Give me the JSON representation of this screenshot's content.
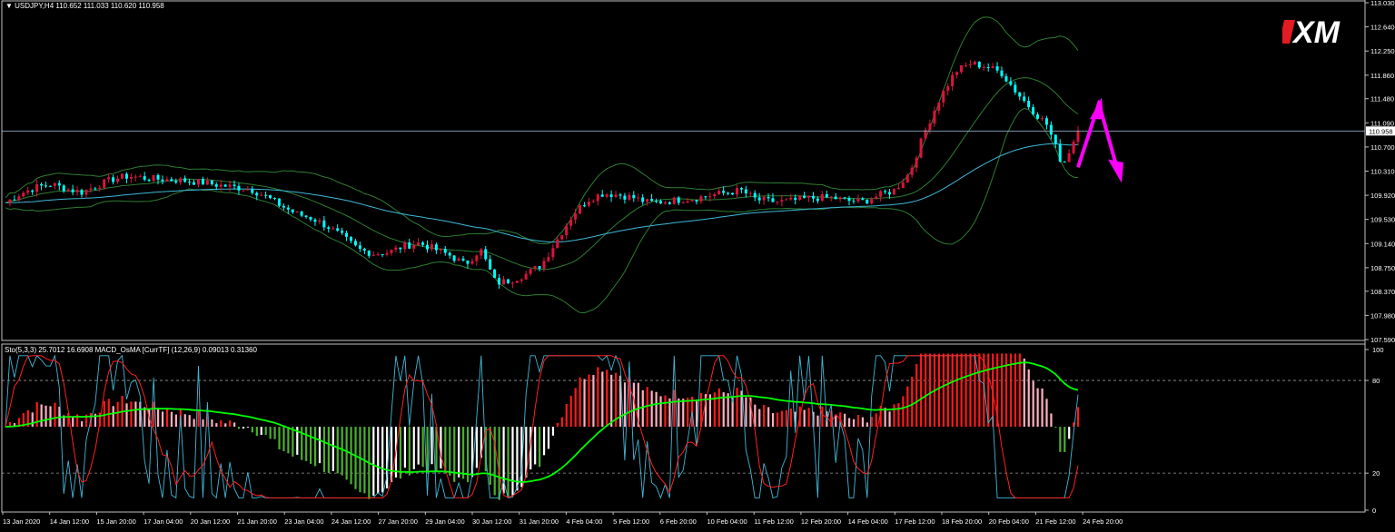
{
  "header": {
    "main": "USDJPY,H4  110.652 111.033 110.620 110.958",
    "sub": "Sto(5,3,3) 25.7012 16.6908  MACD_OsMA [CurrTF] (12,26,9) 0.09013 0.31360"
  },
  "brand": {
    "logo_text": "XM"
  },
  "colors": {
    "background": "#000000",
    "bull_candle": "#dc143c",
    "bear_candle": "#00ffff",
    "band": "#2e7d32",
    "ma": "#3fb8d8",
    "arrow": "#ff00ff",
    "osma_up_rising": "#ff1a1a",
    "osma_up_falling": "#ffb0c0",
    "osma_dn_falling": "#4caf30",
    "osma_dn_rising": "#ffffff",
    "sto_main": "#ff2020",
    "sto_signal": "#3fb8d8",
    "macd_signal": "#00ff00",
    "current_price_bg": "#ffffff"
  },
  "chart_data": [
    {
      "type": "candlestick",
      "symbol": "USDJPY",
      "timeframe": "H4",
      "ohlc_last": {
        "open": 110.652,
        "high": 111.033,
        "low": 110.62,
        "close": 110.958
      },
      "current_price": "110.958",
      "y_ticks": [
        "113.030",
        "112.640",
        "112.250",
        "111.860",
        "111.480",
        "111.090",
        "110.700",
        "110.310",
        "109.920",
        "109.530",
        "109.140",
        "108.750",
        "108.370",
        "107.980",
        "107.590"
      ],
      "ylim": [
        107.59,
        113.03
      ],
      "x_labels": [
        "13 Jan 2020",
        "14 Jan 12:00",
        "15 Jan 20:00",
        "17 Jan 04:00",
        "20 Jan 12:00",
        "21 Jan 20:00",
        "23 Jan 04:00",
        "24 Jan 12:00",
        "27 Jan 20:00",
        "29 Jan 04:00",
        "30 Jan 12:00",
        "31 Jan 20:00",
        "4 Feb 04:00",
        "5 Feb 12:00",
        "6 Feb 20:00",
        "10 Feb 04:00",
        "11 Feb 12:00",
        "12 Feb 20:00",
        "14 Feb 04:00",
        "17 Feb 12:00",
        "18 Feb 20:00",
        "20 Feb 04:00",
        "21 Feb 12:00",
        "24 Feb 20:00"
      ],
      "close_path": [
        109.8,
        109.95,
        110.05,
        110.1,
        110.02,
        109.97,
        110.08,
        110.18,
        110.23,
        110.2,
        110.18,
        110.17,
        110.15,
        110.12,
        110.08,
        110.05,
        110.02,
        109.9,
        109.75,
        109.62,
        109.55,
        109.42,
        109.25,
        109.05,
        108.98,
        109.0,
        109.1,
        109.15,
        109.05,
        108.95,
        108.8,
        109.05,
        108.5,
        108.55,
        108.65,
        108.8,
        109.2,
        109.6,
        109.85,
        109.95,
        109.93,
        109.88,
        109.8,
        109.82,
        109.85,
        109.87,
        109.92,
        109.96,
        110.0,
        109.85,
        109.82,
        109.82,
        109.86,
        109.88,
        109.88,
        109.83,
        109.82,
        109.92,
        110.0,
        110.28,
        110.95,
        111.5,
        111.92,
        112.05,
        112.0,
        111.9,
        111.58,
        111.3,
        111.05,
        110.4,
        110.96
      ]
    },
    {
      "type": "oscillator",
      "indicators": [
        "Sto(5,3,3)",
        "MACD_OsMA [CurrTF] (12,26,9)"
      ],
      "values": {
        "sto_main": 25.7012,
        "sto_signal": 16.6908,
        "osma": 0.09013,
        "macd_signal": 0.3136
      },
      "y_ticks": [
        "100",
        "80",
        "20",
        "0"
      ],
      "levels": [
        80,
        20
      ],
      "ylim": [
        0,
        100
      ]
    }
  ]
}
